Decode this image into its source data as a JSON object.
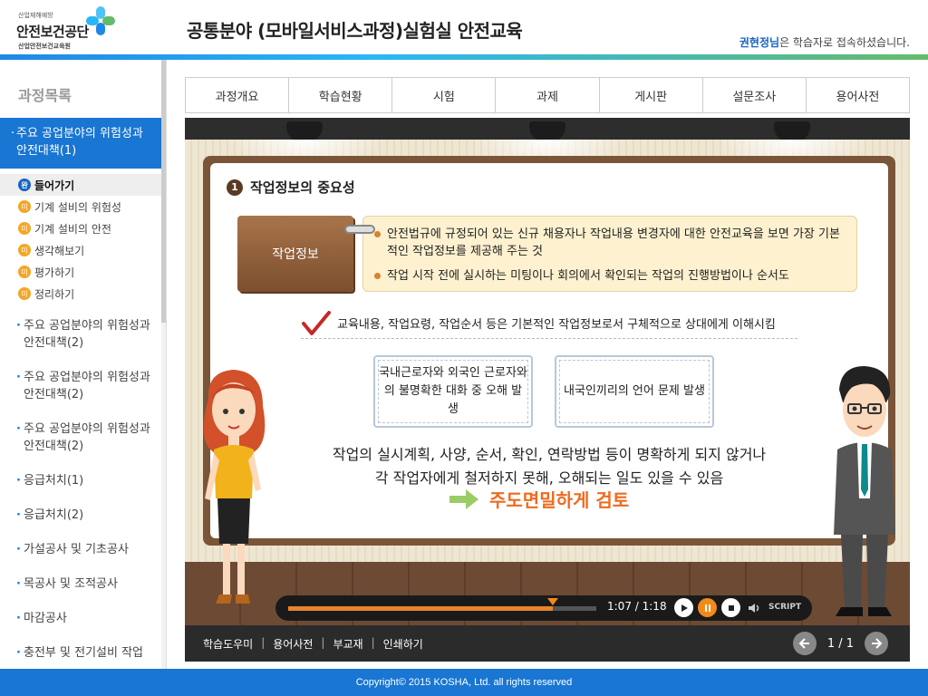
{
  "header": {
    "logo": {
      "tiny": "산업재해예방",
      "main": "안전보건공단",
      "sub": "산업안전보건교육원"
    },
    "title": "공통분야 (모바일서비스과정)실험실 안전교육",
    "user_name": "권현정님",
    "user_status_suffix": "은 학습자로 접속하셨습니다."
  },
  "sidebar": {
    "title": "과정목록",
    "active_course": "주요 공업분야의 위험성과 안전대책(1)",
    "lessons": [
      {
        "badge": "완",
        "label": "들어가기",
        "state": "done"
      },
      {
        "badge": "미",
        "label": "기계 설비의 위험성",
        "state": "todo"
      },
      {
        "badge": "미",
        "label": "기계 설비의 안전",
        "state": "todo"
      },
      {
        "badge": "미",
        "label": "생각해보기",
        "state": "todo"
      },
      {
        "badge": "미",
        "label": "평가하기",
        "state": "todo"
      },
      {
        "badge": "미",
        "label": "정리하기",
        "state": "todo"
      }
    ],
    "courses": [
      "주요 공업분야의 위험성과 안전대책(2)",
      "주요 공업분야의 위험성과 안전대책(2)",
      "주요 공업분야의 위험성과 안전대책(2)",
      "응급처치(1)",
      "응급처치(2)",
      "가설공사 및 기초공사",
      "목공사 및 조적공사",
      "마감공사",
      "충전부 및 전기설비 작업"
    ]
  },
  "tabs": [
    "과정개요",
    "학습현황",
    "시험",
    "과제",
    "게시판",
    "설문조사",
    "용어사전"
  ],
  "slide": {
    "section_number": "1",
    "section_title": "작업정보의 중요성",
    "info_label": "작업정보",
    "bullets": [
      "안전법규에 규정되어 있는 신규 채용자나 작업내용 변경자에 대한 안전교육을 보면 가장 기본적인 작업정보를 제공해 주는 것",
      "작업 시작 전에 실시하는 미팅이나 회의에서 확인되는 작업의 진행방법이나 순서도"
    ],
    "check_text": "교육내용, 작업요령, 작업순서 등은 기본적인 작업정보로서 구체적으로 상대에게 이해시킴",
    "box1": "국내근로자와 외국인 근로자와의 불명확한 대화 중 오해 발생",
    "box2": "내국인끼리의 언어 문제 발생",
    "line1": "작업의 실시계획, 사양, 순서, 확인, 연락방법 등이 명확하게 되지 않거나",
    "line2": "각 작업자에게 철저하지 못해, 오해되는 일도 있을 수 있음",
    "conclusion": "주도면밀하게 검토"
  },
  "player": {
    "current_time": "1:07",
    "total_time": "1:18",
    "progress": 0.859,
    "script_label": "SCRIPT"
  },
  "bottom": {
    "links": [
      "학습도우미",
      "용어사전",
      "부교재",
      "인쇄하기"
    ],
    "page": "1 / 1"
  },
  "footer": "Copyright© 2015 KOSHA, Ltd. all rights reserved"
}
